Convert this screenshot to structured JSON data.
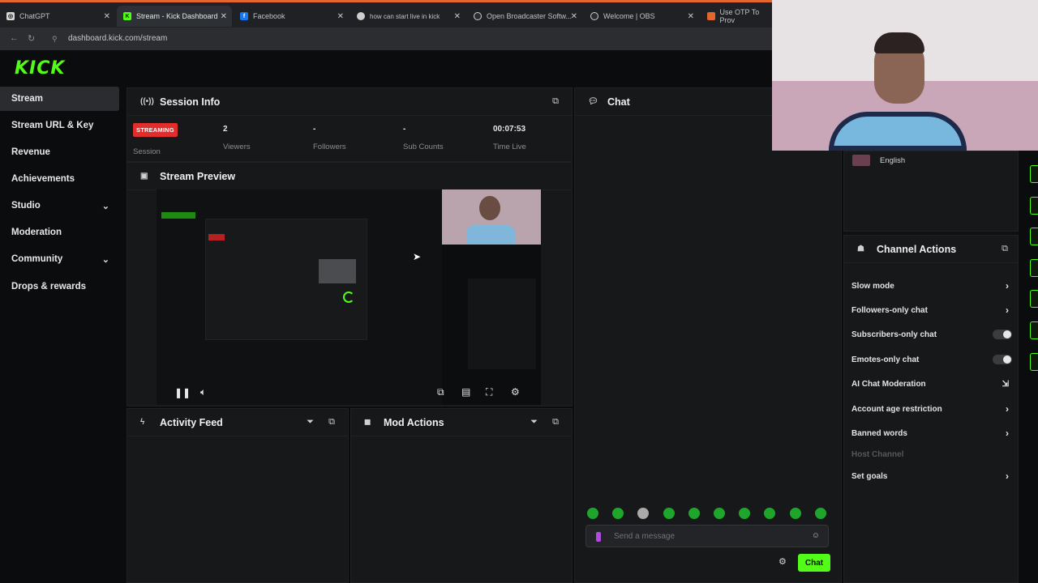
{
  "browser": {
    "tabs": [
      {
        "label": "ChatGPT",
        "favicon": "chatgpt-icon"
      },
      {
        "label": "Stream - Kick Dashboard",
        "favicon": "kick-icon",
        "active": true
      },
      {
        "label": "Facebook",
        "favicon": "facebook-icon"
      },
      {
        "label": "how can start live in kick",
        "favicon": "globe-icon"
      },
      {
        "label": "Open Broadcaster Softw...",
        "favicon": "obs-icon"
      },
      {
        "label": "Welcome | OBS",
        "favicon": "obs-icon"
      },
      {
        "label": "Use OTP To Prov",
        "favicon": "doc-icon"
      }
    ],
    "url": "dashboard.kick.com/stream"
  },
  "app": {
    "logo": "KICK",
    "sidebar": {
      "items": [
        {
          "label": "Stream"
        },
        {
          "label": "Stream URL & Key"
        },
        {
          "label": "Revenue"
        },
        {
          "label": "Achievements"
        },
        {
          "label": "Studio"
        },
        {
          "label": "Moderation"
        },
        {
          "label": "Community"
        },
        {
          "label": "Drops & rewards"
        }
      ]
    },
    "session": {
      "title": "Session Info",
      "status_badge": "STREAMING",
      "stats": [
        {
          "value": "",
          "label": "Session"
        },
        {
          "value": "2",
          "label": "Viewers"
        },
        {
          "value": "-",
          "label": "Followers"
        },
        {
          "value": "-",
          "label": "Sub Counts"
        },
        {
          "value": "00:07:53",
          "label": "Time Live"
        }
      ]
    },
    "preview": {
      "title": "Stream Preview"
    },
    "activity": {
      "title": "Activity Feed"
    },
    "mod_actions": {
      "title": "Mod Actions"
    },
    "chat": {
      "title": "Chat",
      "placeholder": "Send a message",
      "send_label": "Chat",
      "language": "English"
    },
    "channel_actions": {
      "title": "Channel Actions",
      "rows": [
        {
          "label": "Slow mode",
          "kind": "arrow"
        },
        {
          "label": "Followers-only chat",
          "kind": "arrow"
        },
        {
          "label": "Subscribers-only chat",
          "kind": "toggle"
        },
        {
          "label": "Emotes-only chat",
          "kind": "toggle"
        },
        {
          "label": "AI Chat Moderation",
          "kind": "external"
        },
        {
          "label": "Account age restriction",
          "kind": "arrow"
        },
        {
          "label": "Banned words",
          "kind": "arrow"
        },
        {
          "label": "Host Channel",
          "kind": "disabled"
        },
        {
          "label": "Set goals",
          "kind": "arrow"
        }
      ]
    }
  },
  "colors": {
    "accent": "#53fc18",
    "streaming": "#e22d2d",
    "panel": "#16181a"
  }
}
